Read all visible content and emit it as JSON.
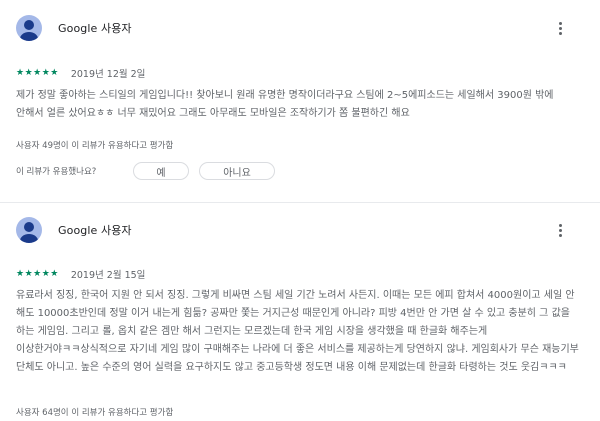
{
  "reviews": [
    {
      "author": "Google 사용자",
      "stars": "★★★★★",
      "rating": 5,
      "date": "2019년 12월 2일",
      "body": "제가 정말 좋아하는 스티일의 게임입니다!! 찾아보니 원래 유명한 명작이더라구요 스팀에 2~5에피소드는 세일해서 3900원 밖에 안해서 얼른 샀어요ㅎㅎ 너무 재밌어요 그래도 아무래도 모바일은 조작하기가 쫌 불편하긴 해요",
      "helpful": "사용자 49명이 이 리뷰가 유용하다고 평가함",
      "feedback_question": "이 리뷰가 유용했나요?",
      "yes_label": "예",
      "no_label": "아니요"
    },
    {
      "author": "Google 사용자",
      "stars": "★★★★★",
      "rating": 5,
      "date": "2019년 2월 15일",
      "body": "유료라서 징징, 한국어 지원 안 되서 징징. 그렇게 비싸면 스팀 세일 기간 노려서 사든지. 이때는 모든 에피 합쳐서 4000원이고 세일 안 해도 10000초반인데 정말 이거 내는게 힘듦? 공짜만 쫓는 거지근성 때문인게 아니라? 피방 4번만 안 가면 살 수 있고 충분히 그 값을 하는 게임임. 그리고 롤, 옵치 같은 겜만 해서 그런지는 모르겠는데 한국 게임 시장을 생각했을 때 한글화 해주는게 이상한거야ㅋㅋ상식적으로 자기네 게임 많이 구매해주는 나라에 더 좋은 서비스를 제공하는게 당연하지 않냐. 게임회사가 무슨 재능기부 단체도 아니고. 높은 수준의 영어 실력을 요구하지도 않고 중고등학생 정도면 내용 이해 문제없는데 한글화 타령하는 것도 웃김ㅋㅋㅋ",
      "helpful": "사용자 64명이 이 리뷰가 유용하다고 평가함"
    }
  ]
}
